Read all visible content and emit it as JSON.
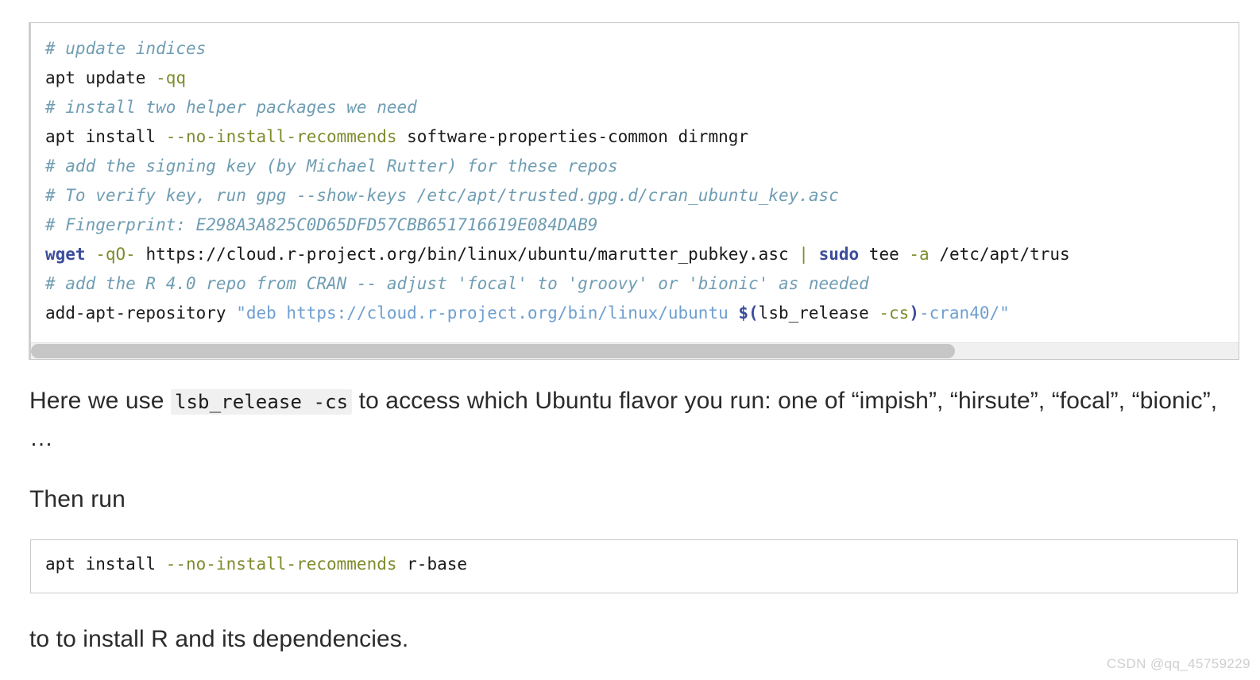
{
  "code_block_1": {
    "name": "shell-install-script",
    "language": "bash",
    "scrollbar": {
      "orientation": "horizontal",
      "thumb_fraction_percent": 76.5
    },
    "lines": [
      {
        "id": "l1",
        "tokens": [
          {
            "type": "comment",
            "text": "# update indices"
          }
        ]
      },
      {
        "id": "l2",
        "tokens": [
          {
            "type": "plain",
            "text": "apt update "
          },
          {
            "type": "opt",
            "text": "-qq"
          }
        ]
      },
      {
        "id": "l3",
        "tokens": [
          {
            "type": "comment",
            "text": "# install two helper packages we need"
          }
        ]
      },
      {
        "id": "l4",
        "tokens": [
          {
            "type": "plain",
            "text": "apt install "
          },
          {
            "type": "opt",
            "text": "--no-install-recommends"
          },
          {
            "type": "plain",
            "text": " software-properties-common dirmngr"
          }
        ]
      },
      {
        "id": "l5",
        "tokens": [
          {
            "type": "comment",
            "text": "# add the signing key (by Michael Rutter) for these repos"
          }
        ]
      },
      {
        "id": "l6",
        "tokens": [
          {
            "type": "comment",
            "text": "# To verify key, run gpg --show-keys /etc/apt/trusted.gpg.d/cran_ubuntu_key.asc"
          }
        ]
      },
      {
        "id": "l7",
        "tokens": [
          {
            "type": "comment",
            "text": "# Fingerprint: E298A3A825C0D65DFD57CBB651716619E084DAB9"
          }
        ]
      },
      {
        "id": "l8",
        "tokens": [
          {
            "type": "kw",
            "text": "wget"
          },
          {
            "type": "plain",
            "text": " "
          },
          {
            "type": "opt",
            "text": "-qO-"
          },
          {
            "type": "plain",
            "text": " https://cloud.r-project.org/bin/linux/ubuntu/marutter_pubkey.asc "
          },
          {
            "type": "pipe",
            "text": "|"
          },
          {
            "type": "plain",
            "text": " "
          },
          {
            "type": "kw",
            "text": "sudo"
          },
          {
            "type": "plain",
            "text": " tee "
          },
          {
            "type": "opt",
            "text": "-a"
          },
          {
            "type": "plain",
            "text": " /etc/apt/trus"
          }
        ]
      },
      {
        "id": "l9",
        "tokens": [
          {
            "type": "comment",
            "text": "# add the R 4.0 repo from CRAN -- adjust 'focal' to 'groovy' or 'bionic' as needed"
          }
        ]
      },
      {
        "id": "l10",
        "tokens": [
          {
            "type": "plain",
            "text": "add-apt-repository "
          },
          {
            "type": "str",
            "text": "\"deb https://cloud.r-project.org/bin/linux/ubuntu "
          },
          {
            "type": "punct",
            "text": "$("
          },
          {
            "type": "plain",
            "text": "lsb_release "
          },
          {
            "type": "opt",
            "text": "-cs"
          },
          {
            "type": "punct",
            "text": ")"
          },
          {
            "type": "str",
            "text": "-cran40/\""
          }
        ]
      }
    ]
  },
  "paragraph_1": {
    "before_code": "Here we use ",
    "inline_code": "lsb_release -cs",
    "after_code": " to access which Ubuntu flavor you run: one of “impish”, “hirsute”, “focal”, “bionic”, …"
  },
  "paragraph_2": {
    "text": "Then run"
  },
  "code_block_2": {
    "name": "apt-install-r-base",
    "language": "bash",
    "lines": [
      {
        "id": "s1",
        "tokens": [
          {
            "type": "plain",
            "text": "apt install "
          },
          {
            "type": "opt",
            "text": "--no-install-recommends"
          },
          {
            "type": "plain",
            "text": " r-base"
          }
        ]
      }
    ]
  },
  "paragraph_3": {
    "text": "to to install R and its dependencies."
  },
  "watermark": {
    "text": "CSDN @qq_45759229"
  },
  "colors": {
    "comment": "#6f9db3",
    "option": "#7f8b2d",
    "keyword": "#3b4c9c",
    "string": "#6f9fd0",
    "plain": "#1a1a1a",
    "code_border": "#c9c9c9",
    "scrollbar_track": "#f0f0f0",
    "scrollbar_thumb": "#c6c6c6",
    "inline_code_bg": "#f0f0f0",
    "body_text": "#2b2b2b",
    "watermark": "#cfcfcf",
    "background": "#ffffff"
  }
}
